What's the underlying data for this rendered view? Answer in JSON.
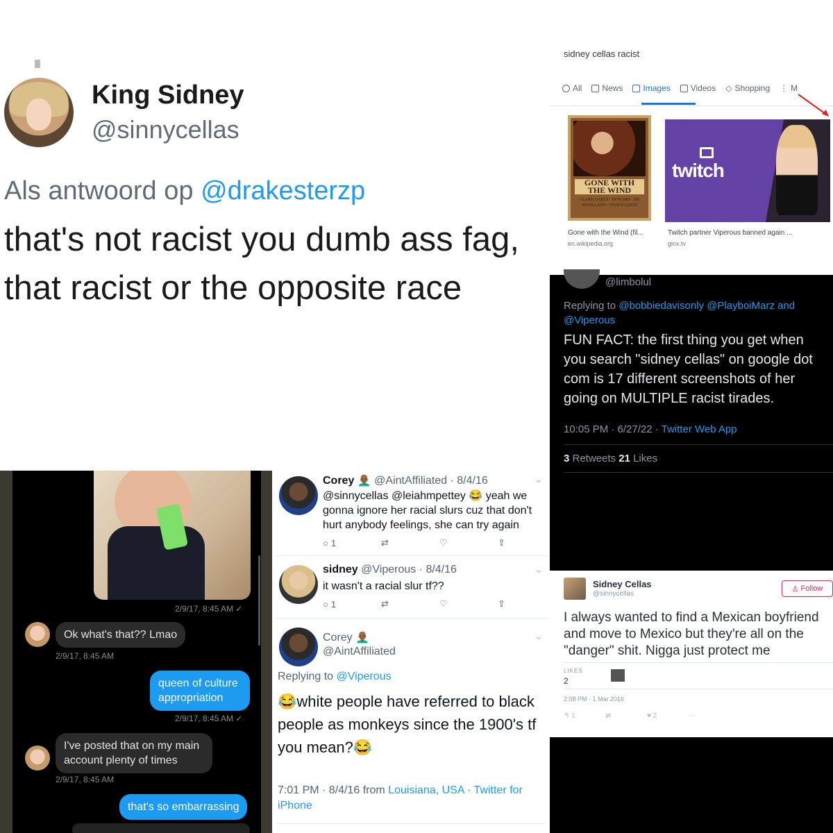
{
  "panel_a": {
    "name": "King Sidney",
    "handle": "@sinnycellas",
    "reply_prefix": "Als antwoord op ",
    "reply_mention": "@drakesterzp",
    "body_line1": "that's not racist you dumb ass fag,",
    "body_line2": "that racist or the opposite race"
  },
  "panel_b": {
    "query": "sidney cellas racist",
    "tabs": [
      {
        "label": "All",
        "icon": "search-icon"
      },
      {
        "label": "News",
        "icon": "news-icon"
      },
      {
        "label": "Images",
        "icon": "image-icon"
      },
      {
        "label": "Videos",
        "icon": "video-icon"
      },
      {
        "label": "Shopping",
        "icon": "tag-icon"
      },
      {
        "label": "M",
        "icon": "more-vertical-icon"
      }
    ],
    "active_tab": "Images",
    "poster_title": "GONE WITH THE WIND",
    "poster_cast": "CLARK GABLE · HOWARD · DE HAVILLAND · VIVIEN LEIGH",
    "twitch_logo": "twitch",
    "results": [
      {
        "caption": "Gone with the Wind (fil...",
        "source": "en.wikipedia.org"
      },
      {
        "caption": "Twitch partner Viperous banned again ...",
        "source": "ginx.tv"
      }
    ],
    "accent": "#1a73e8"
  },
  "panel_c": {
    "handle": "@limbolul",
    "replying_prefix": "Replying to ",
    "replying_mentions": "@bobbiedavisonly @PlayboiMarz and @Viperous",
    "text": "FUN FACT: the first thing you get when you search \"sidney cellas\" on google dot com is 17 different screenshots of her going on MULTIPLE racist tirades.",
    "time": "10:05 PM · 6/27/22 · ",
    "client": "Twitter Web App",
    "retweets": "3",
    "retweets_label": " Retweets ",
    "likes": "21",
    "likes_label": " Likes"
  },
  "panel_d": {
    "photo_ts": "2/9/17, 8:45 AM ✓",
    "messages": [
      {
        "dir": "in",
        "text": "Ok what's that?? Lmao",
        "ts": "2/9/17, 8:45 AM"
      },
      {
        "dir": "out",
        "text": "queen of culture appropriation",
        "ts": "2/9/17, 8:45 AM ✓"
      },
      {
        "dir": "in",
        "text": "I've posted that on my main account plenty of times",
        "ts": "2/9/17, 8:45 AM"
      },
      {
        "dir": "out",
        "text": "that's so embarrassing",
        "ts": ""
      }
    ]
  },
  "panel_e": {
    "t1_name": "Corey 👨🏾‍🦲",
    "t1_meta": "@AintAffiliated · 8/4/16",
    "t1_text": "@sinnycellas @leiahmpettey 😂 yeah we gonna ignore her racial slurs cuz that don't hurt anybody feelings, she can try again",
    "t1_replies": "1",
    "t2_name": "sidney",
    "t2_meta": "@Viperous · 8/4/16",
    "t2_text": "it wasn't a racial slur tf??",
    "t2_replies": "1",
    "t3_name": "Corey 👨🏾‍🦲",
    "t3_handle": "@AintAffiliated",
    "t3_reply_prefix": "Replying to ",
    "t3_reply_mention": "@Viperous",
    "t3_text": "😂white people have referred to black people as monkeys since the 1900's tf you mean?😂",
    "t3_time": "7:01 PM · 8/4/16 from ",
    "t3_location": "Louisiana, USA",
    "t3_sep": " · ",
    "t3_client": "Twitter for iPhone"
  },
  "panel_f": {
    "name": "Sidney Cellas",
    "handle": "@sinnycellas",
    "follow_label": "Follow",
    "text": "I always wanted to find a Mexican boyfriend and move to Mexico but they're all on the \"danger\" shit. Nigga just protect me",
    "likes_label": "LIKES",
    "likes": "2",
    "date": "2:08 PM - 1 Mar 2016",
    "reply_count": "1",
    "like_count": "2"
  }
}
